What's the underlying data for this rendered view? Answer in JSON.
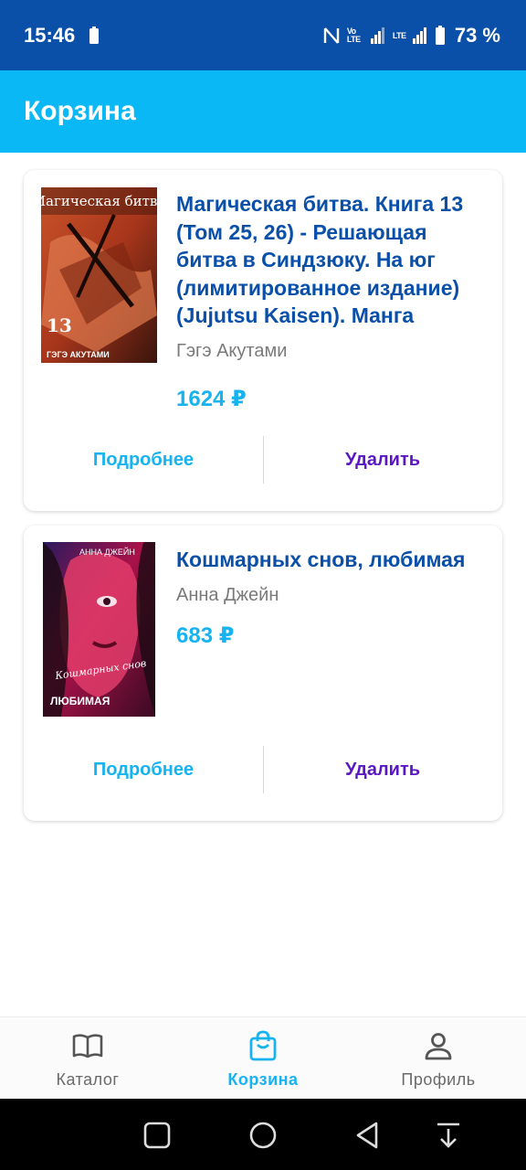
{
  "status_bar": {
    "time": "15:46",
    "battery_percent": "73 %",
    "volte_label": "Vo LTE",
    "lte_label": "LTE"
  },
  "app_bar": {
    "title": "Корзина"
  },
  "cart": {
    "items": [
      {
        "title": "Магическая битва. Книга 13 (Том 25, 26) - Решающая битва в Синдзюку. На юг (лимитированное издание) (Jujutsu Kaisen). Манга",
        "author": "Гэгэ Акутами",
        "price": "1624 ₽",
        "cover_title": "Магическая битва",
        "cover_number": "13",
        "cover_author": "ГЭГЭ АКУТАМИ",
        "details_label": "Подробнее",
        "remove_label": "Удалить"
      },
      {
        "title": "Кошмарных снов, любимая",
        "author": "Анна Джейн",
        "price": "683 ₽",
        "cover_author": "АННА ДЖЕЙН",
        "cover_script": "Кошмарных снов",
        "cover_title": "ЛЮБИМАЯ",
        "details_label": "Подробнее",
        "remove_label": "Удалить"
      }
    ]
  },
  "bottom_nav": {
    "items": [
      {
        "label": "Каталог",
        "icon": "book-open-icon",
        "active": false
      },
      {
        "label": "Корзина",
        "icon": "shopping-bag-icon",
        "active": true
      },
      {
        "label": "Профиль",
        "icon": "person-icon",
        "active": false
      }
    ]
  },
  "colors": {
    "status_bar": "#0a4fa8",
    "app_bar": "#0ab8f5",
    "title_text": "#0a4fa8",
    "price_accent": "#17b3f0",
    "remove_text": "#5b17c4"
  }
}
